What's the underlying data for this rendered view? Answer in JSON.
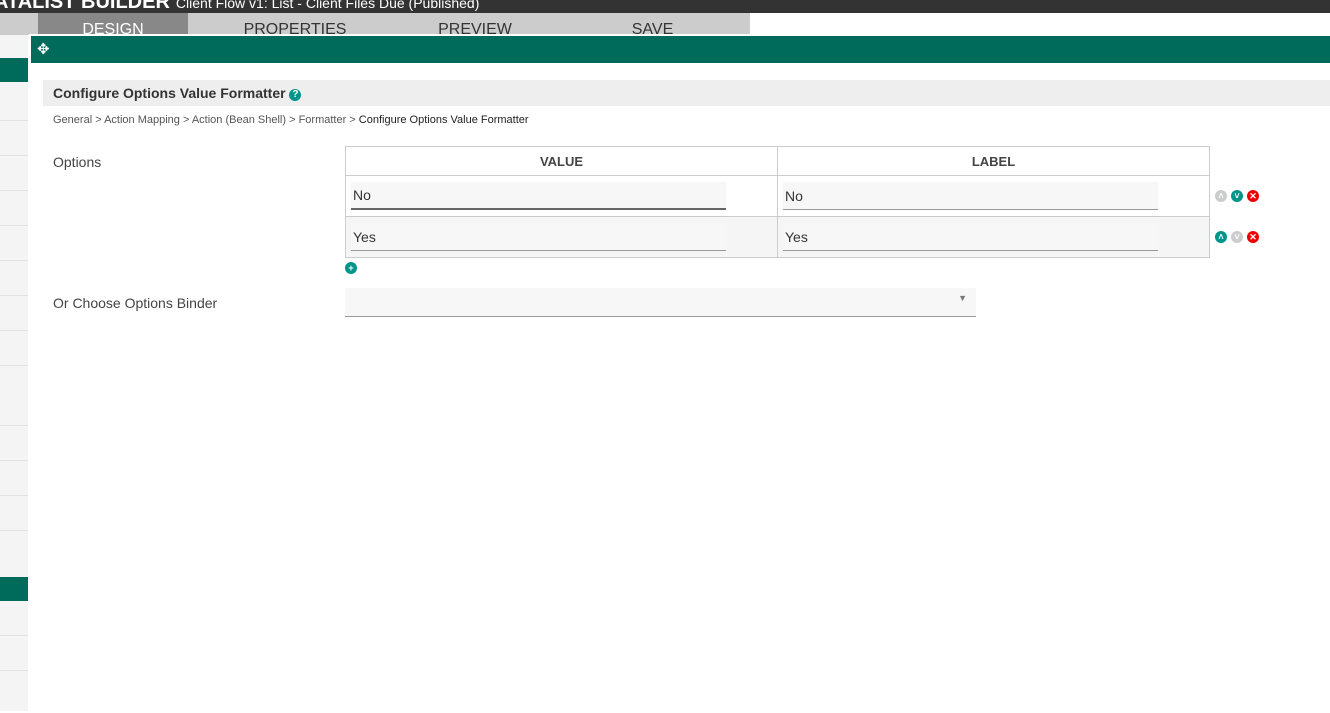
{
  "app": {
    "title": "ATALIST BUILDER",
    "subtitle": "Client Flow v1: List - Client Files Due (Published)"
  },
  "tabs": [
    "DESIGN",
    "PROPERTIES",
    "PREVIEW",
    "SAVE"
  ],
  "dialog": {
    "move_icon": "✥",
    "title": "Configure Options Value Formatter",
    "breadcrumb": [
      "General",
      "Action Mapping",
      "Action (Bean Shell)",
      "Formatter"
    ],
    "breadcrumb_current": "Configure Options Value Formatter",
    "options_label": "Options",
    "columns": [
      "VALUE",
      "LABEL"
    ],
    "rows": [
      {
        "value": "No",
        "label": "No"
      },
      {
        "value": "Yes",
        "label": "Yes"
      }
    ],
    "binder_label": "Or Choose Options Binder",
    "binder_value": ""
  }
}
